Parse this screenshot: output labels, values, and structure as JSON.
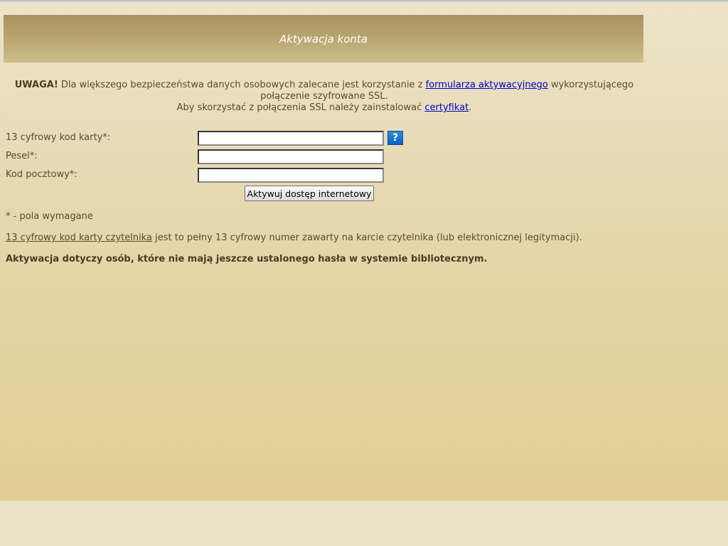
{
  "header": {
    "title": "Aktywacja konta"
  },
  "notice": {
    "warning_label": "UWAGA!",
    "text_before_link": " Dla większego bezpieczeństwa danych osobowych zalecane jest korzystanie z ",
    "form_link_text": "formularza aktywacyjnego",
    "text_after_link": " wykorzystującego połączenie szyfrowane SSL.",
    "ssl_text": "Aby skorzystać z połączenia SSL należy zainstalować ",
    "certificate_link_text": "certyfikat",
    "ssl_text_end": "."
  },
  "form": {
    "card_label": "13 cyfrowy kod karty*:",
    "card_value": "",
    "pesel_label": "Pesel*:",
    "pesel_value": "",
    "postal_label": "Kod pocztowy*:",
    "postal_value": "",
    "help_icon_text": "?",
    "submit_label": "Aktywuj dostęp internetowy"
  },
  "notes": {
    "required": "* - pola wymagane",
    "card_link_text": "13 cyfrowy kod karty czytelnika",
    "card_description": " jest to pełny 13 cyfrowy numer zawarty na karcie czytelnika (lub elektronicznej legitymacji).",
    "activation_note": "Aktywacja dotyczy osób, które nie mają jeszcze ustalonego hasła w systemie bibliotecznym."
  },
  "icons": {
    "help": "question-mark-icon"
  },
  "colors": {
    "header_bar": "#b9a56f",
    "link": "#0000cc",
    "help_button": "#1a74d6",
    "page_background": "#e3d4a3"
  }
}
